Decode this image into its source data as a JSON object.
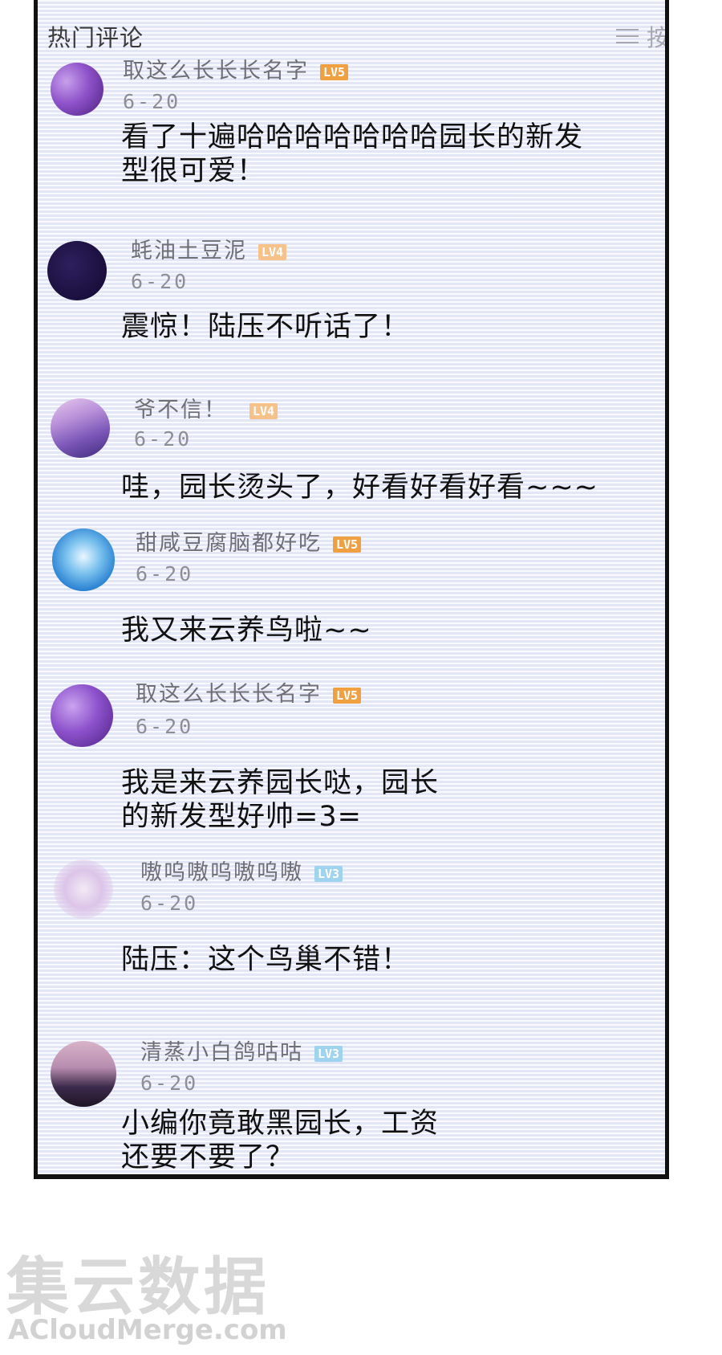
{
  "header": {
    "title": "热门评论",
    "sort_label": "按"
  },
  "comments": [
    {
      "username": "取这么长长长名字",
      "level": "LV5",
      "date": "6-20",
      "text": "看了十遍哈哈哈哈哈哈哈园长的新发型很可爱！"
    },
    {
      "username": "蚝油土豆泥",
      "level": "LV4",
      "date": "6-20",
      "text": "震惊！陆压不听话了！"
    },
    {
      "username": "爷不信！",
      "level": "LV4",
      "date": "6-20",
      "text": "哇，园长烫头了，好看好看好看~~~"
    },
    {
      "username": "甜咸豆腐脑都好吃",
      "level": "LV5",
      "date": "6-20",
      "text": "我又来云养鸟啦~~"
    },
    {
      "username": "取这么长长长名字",
      "level": "LV5",
      "date": "6-20",
      "text": "我是来云养园长哒，园长的新发型好帅=3="
    },
    {
      "username": "嗷呜嗷呜嗷呜嗷",
      "level": "LV3",
      "date": "6-20",
      "text": "陆压：这个鸟巢不错！"
    },
    {
      "username": "清蒸小白鸽咕咕",
      "level": "LV3",
      "date": "6-20",
      "text": "小编你竟敢黑园长，工资还要不要了？"
    }
  ],
  "watermark": {
    "cn": "集云数据",
    "en": "ACloudMerge.com"
  },
  "colors": {
    "lv5_badge": "#f0a040",
    "lv4_badge": "#f6c28a",
    "lv3_badge": "#9fd3ee"
  }
}
